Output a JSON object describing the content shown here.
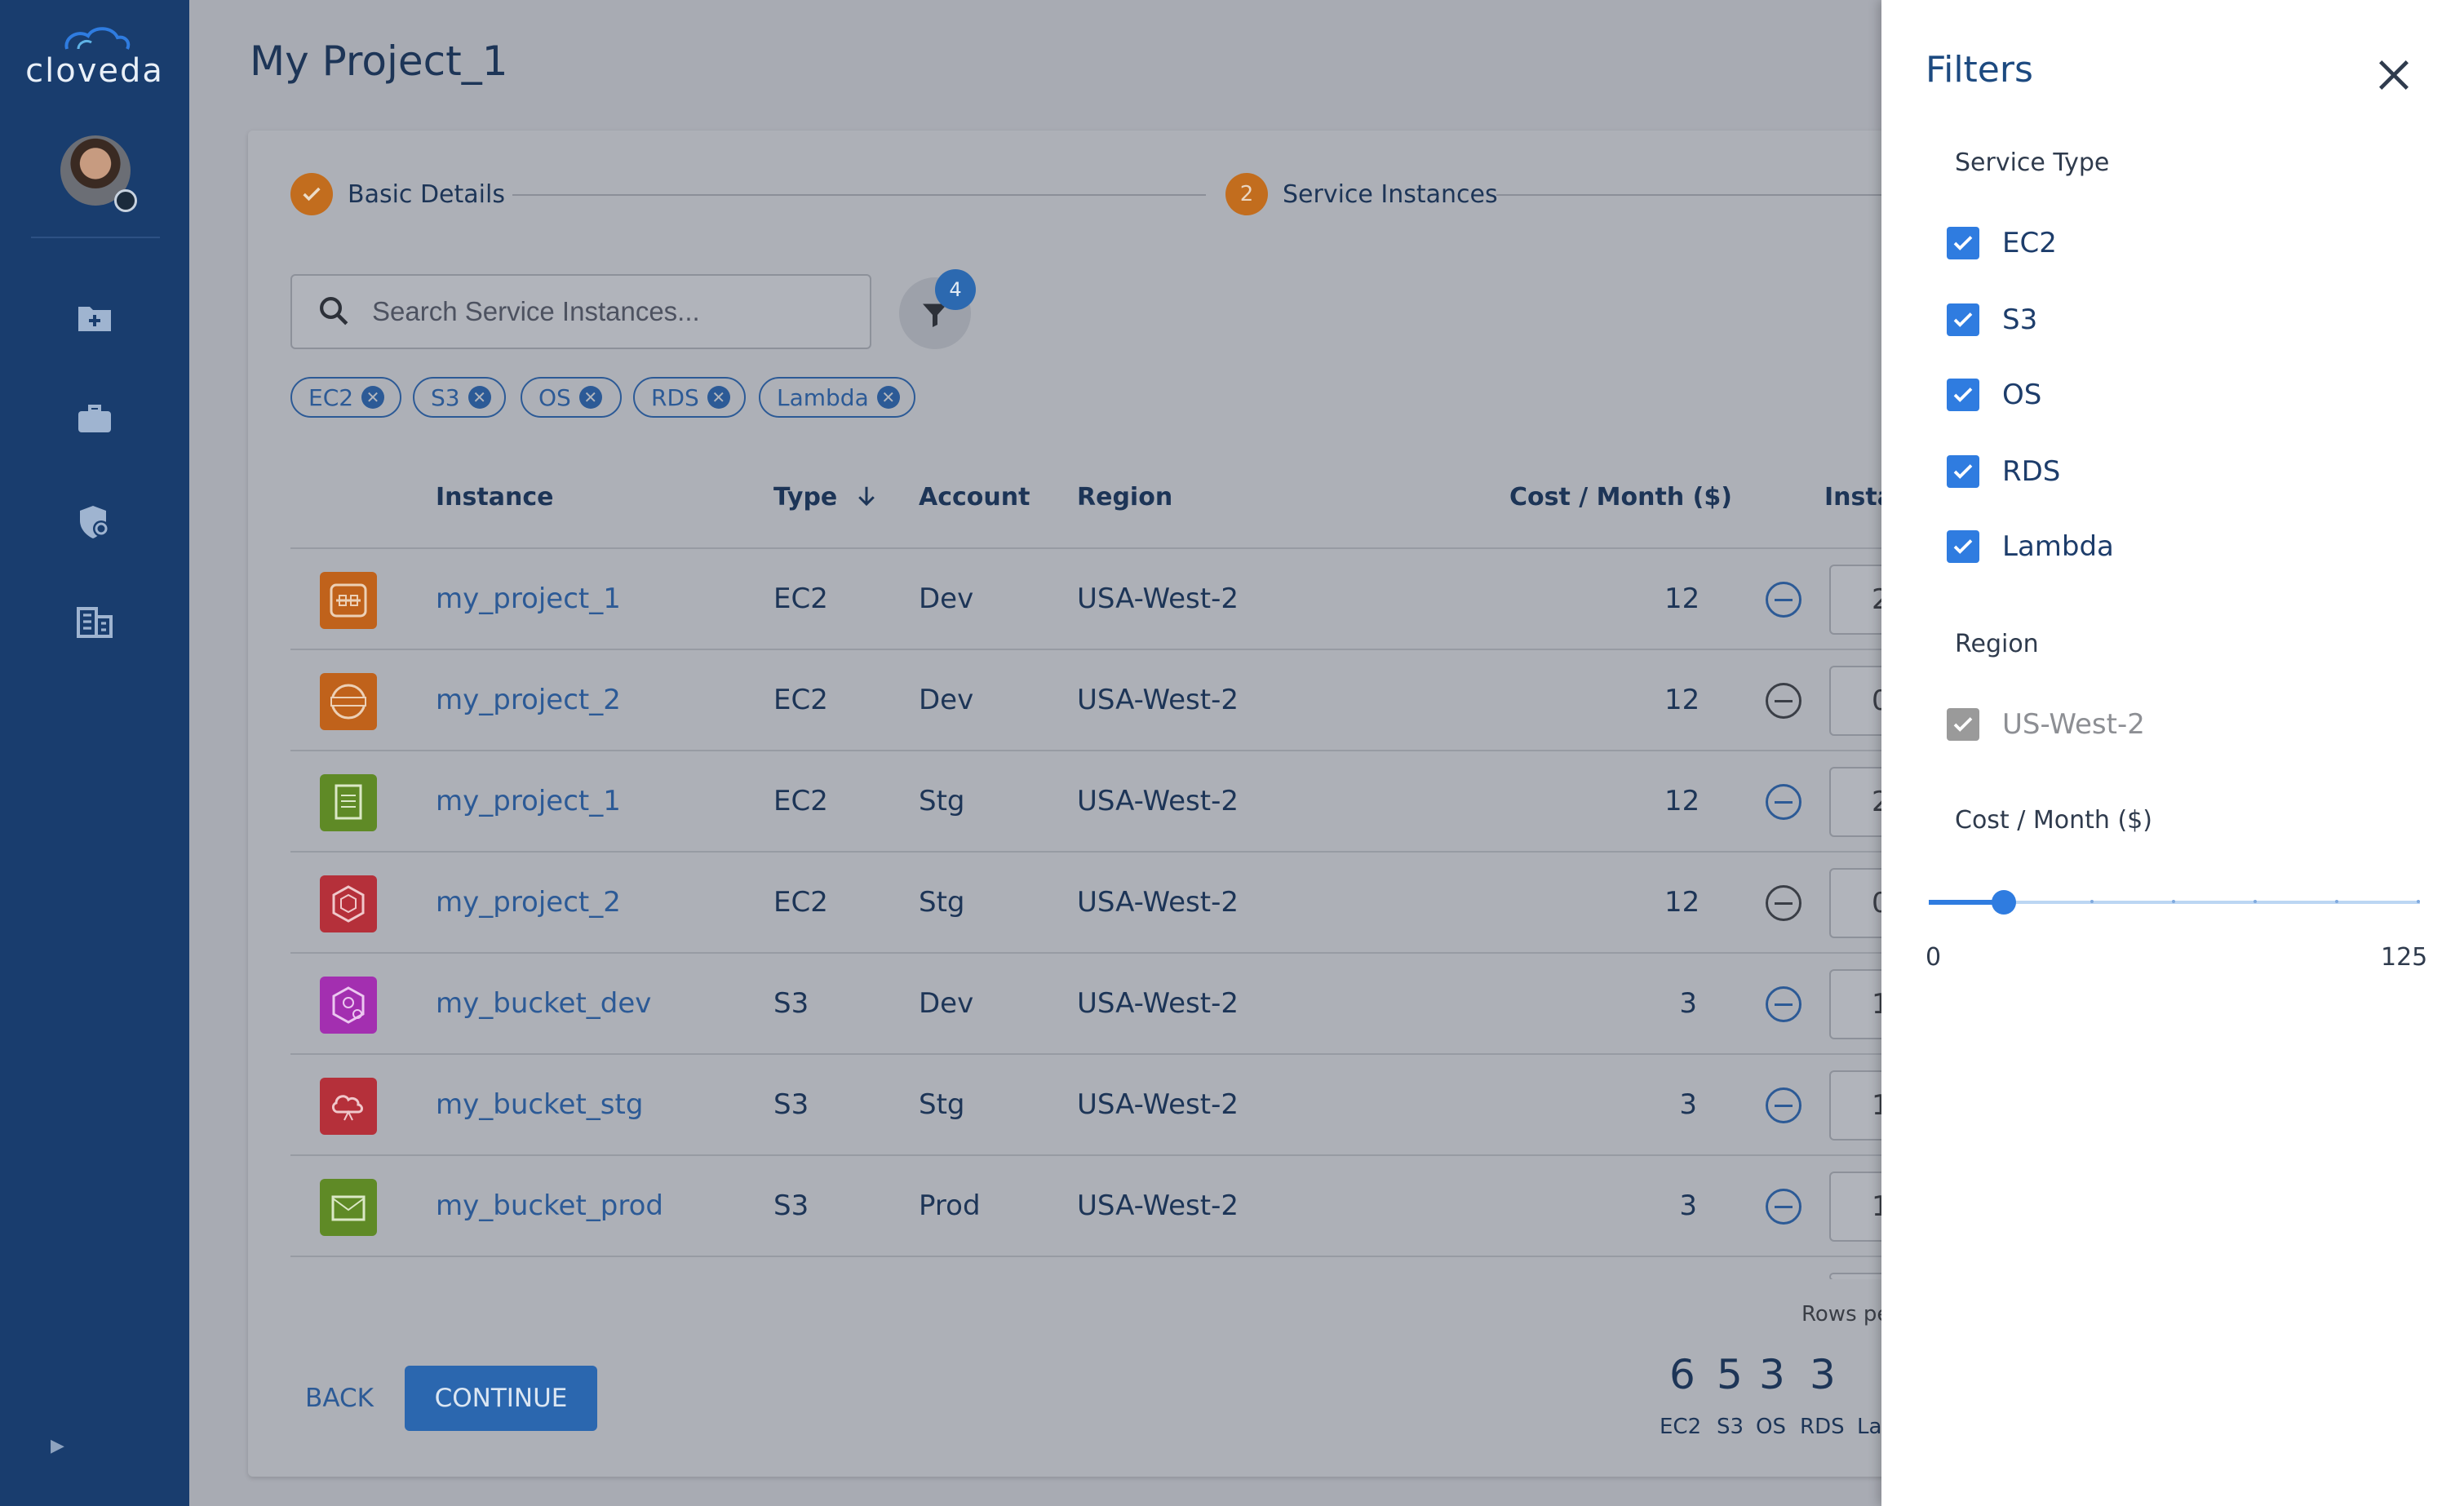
{
  "app": {
    "logo_text": "cloveda"
  },
  "page": {
    "title": "My Project_1"
  },
  "stepper": {
    "steps": [
      {
        "label": "Basic Details",
        "status": "completed"
      },
      {
        "label": "Service Instances",
        "number": "2",
        "status": "active"
      }
    ]
  },
  "search": {
    "placeholder": "Search Service Instances...",
    "value": ""
  },
  "filter_button": {
    "badge": "4"
  },
  "chips": [
    "EC2",
    "S3",
    "OS",
    "RDS",
    "Lambda"
  ],
  "table": {
    "headers": {
      "instance": "Instance",
      "type": "Type",
      "account": "Account",
      "region": "Region",
      "cost": "Cost / Month ($)",
      "instances": "Insta"
    },
    "rows": [
      {
        "instance": "my_project_1",
        "type": "EC2",
        "account": "Dev",
        "region": "USA-West-2",
        "cost": "12",
        "qty": "2"
      },
      {
        "instance": "my_project_2",
        "type": "EC2",
        "account": "Dev",
        "region": "USA-West-2",
        "cost": "12",
        "qty": "0"
      },
      {
        "instance": "my_project_1",
        "type": "EC2",
        "account": "Stg",
        "region": "USA-West-2",
        "cost": "12",
        "qty": "2"
      },
      {
        "instance": "my_project_2",
        "type": "EC2",
        "account": "Stg",
        "region": "USA-West-2",
        "cost": "12",
        "qty": "0"
      },
      {
        "instance": "my_bucket_dev",
        "type": "S3",
        "account": "Dev",
        "region": "USA-West-2",
        "cost": "3",
        "qty": "1"
      },
      {
        "instance": "my_bucket_stg",
        "type": "S3",
        "account": "Stg",
        "region": "USA-West-2",
        "cost": "3",
        "qty": "1"
      },
      {
        "instance": "my_bucket_prod",
        "type": "S3",
        "account": "Prod",
        "region": "USA-West-2",
        "cost": "3",
        "qty": "1"
      }
    ],
    "rows_per_page_label": "Rows pe"
  },
  "actions": {
    "back": "BACK",
    "continue": "CONTINUE"
  },
  "summary": [
    {
      "count": "6",
      "label": "EC2"
    },
    {
      "count": "5",
      "label": "S3"
    },
    {
      "count": "3",
      "label": "OS"
    },
    {
      "count": "3",
      "label": "RDS"
    },
    {
      "count": "",
      "label": "La"
    }
  ],
  "filters": {
    "title": "Filters",
    "service_type": {
      "label": "Service Type",
      "options": [
        {
          "label": "EC2",
          "checked": true
        },
        {
          "label": "S3",
          "checked": true
        },
        {
          "label": "OS",
          "checked": true
        },
        {
          "label": "RDS",
          "checked": true
        },
        {
          "label": "Lambda",
          "checked": true
        }
      ]
    },
    "region": {
      "label": "Region",
      "options": [
        {
          "label": "US-West-2",
          "checked": true,
          "disabled": true
        }
      ]
    },
    "cost": {
      "label": "Cost / Month ($)",
      "min": "0",
      "max": "125",
      "value": 16
    }
  },
  "colors": {
    "sidebar": "#193d6e",
    "accent": "#2f7ce0",
    "step": "#c26d1e",
    "overlay": "#a8abb3"
  }
}
